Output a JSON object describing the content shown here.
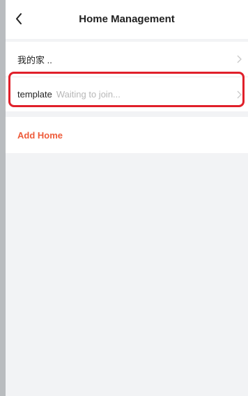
{
  "header": {
    "title": "Home Management",
    "back_icon": "chevron-left-icon"
  },
  "homes": [
    {
      "name": "我的家 ..",
      "status": ""
    },
    {
      "name": "template",
      "status": "Waiting to join..."
    }
  ],
  "add_home_label": "Add Home",
  "colors": {
    "accent": "#ee5b3a",
    "highlight": "#e0202a",
    "background": "#f2f3f5"
  }
}
